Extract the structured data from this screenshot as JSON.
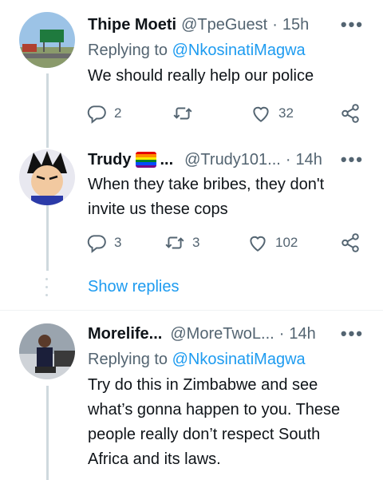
{
  "tweets": [
    {
      "name": "Thipe Moeti",
      "handle": "@TpeGuest",
      "dot": "·",
      "time": "15h",
      "replying_prefix": "Replying to",
      "replying_to": "@NkosinatiMagwa",
      "text": "We should really help our police",
      "replies": "2",
      "retweets": "",
      "likes": "32"
    },
    {
      "name": "Trudy",
      "name_suffix": "...",
      "handle": "@Trudy101...",
      "dot": "·",
      "time": "14h",
      "text": "When they take bribes, they don't invite us these cops",
      "replies": "3",
      "retweets": "3",
      "likes": "102"
    },
    {
      "name": "Morelife...",
      "handle": "@MoreTwoL...",
      "dot": "·",
      "time": "14h",
      "replying_prefix": "Replying to",
      "replying_to": "@NkosinatiMagwa",
      "text": "Try do this in Zimbabwe and see what’s gonna happen to you. These people really don’t respect South Africa and its laws."
    }
  ],
  "show_replies_label": "Show replies",
  "more_label": "•••",
  "colors": {
    "accent": "#1d9bf0",
    "secondary_text": "#536471",
    "primary_text": "#0f1419",
    "thread_line": "#cfd9de"
  },
  "icons": {
    "reply": "reply-icon",
    "retweet": "retweet-icon",
    "like": "heart-icon",
    "share": "share-icon",
    "more": "more-icon",
    "flag": "rainbow-flag-icon"
  }
}
